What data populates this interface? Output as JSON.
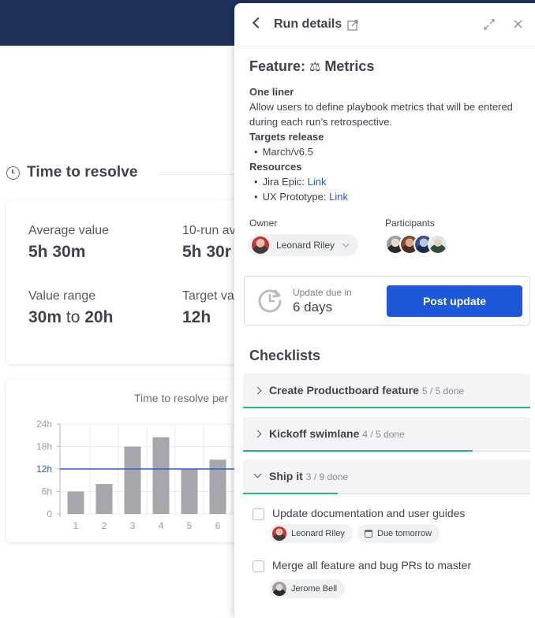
{
  "background": {
    "section_title": "Time to resolve",
    "stats": [
      {
        "label": "Average value",
        "value": "5h 30m"
      },
      {
        "label": "10-run av",
        "value": "5h 30r"
      },
      {
        "label": "Value range",
        "value_from": "30m",
        "value_to_word": "to",
        "value_to": "20h"
      },
      {
        "label": "Target va",
        "value": "12h"
      }
    ],
    "chart_title": "Time to resolve per"
  },
  "chart_data": {
    "type": "bar",
    "title": "Time to resolve per",
    "categories": [
      "1",
      "2",
      "3",
      "4",
      "5",
      "6"
    ],
    "values": [
      6,
      8,
      18,
      20.5,
      12,
      14.5
    ],
    "y_ticks": [
      "0",
      "6h",
      "12h",
      "18h",
      "24h"
    ],
    "ylim": [
      0,
      24
    ],
    "target_line": 12,
    "target_label": "12h",
    "colors": {
      "bar": "#a5a7ad",
      "target": "#2f5fd0",
      "grid": "#ececef"
    }
  },
  "panel": {
    "title": "Run details",
    "feature_prefix": "Feature:",
    "feature_emoji": "⚖",
    "feature_name": "Metrics",
    "one_liner_heading": "One liner",
    "one_liner_text": "Allow users to define playbook metrics that will be entered during each run’s retrospective.",
    "targets_heading": "Targets release",
    "targets_item": "March/v6.5",
    "resources_heading": "Resources",
    "resources": [
      {
        "prefix": "Jira Epic: ",
        "link": "Link"
      },
      {
        "prefix": "UX Prototype: ",
        "link": "Link"
      }
    ],
    "owner_label": "Owner",
    "owner_name": "Leonard Riley",
    "participants_label": "Participants",
    "update_label": "Update due in",
    "update_value": "6 days",
    "post_button": "Post update",
    "checklists_heading": "Checklists",
    "checklists": [
      {
        "name": "Create Productboard feature",
        "count": "5 / 5 done",
        "progress": 1.0
      },
      {
        "name": "Kickoff swimlane",
        "count": "4 / 5 done",
        "progress": 0.8
      },
      {
        "name": "Ship it",
        "count": "3 / 9 done",
        "progress": 0.33
      }
    ],
    "tasks": [
      {
        "text": "Update documentation and user guides",
        "assignee": "Leonard Riley",
        "due": "Due tomorrow"
      },
      {
        "text": "Merge all feature and bug PRs to master",
        "assignee": "Jerome Bell"
      }
    ],
    "accent_color": "#1c58d9",
    "progress_color": "#26b68b"
  }
}
